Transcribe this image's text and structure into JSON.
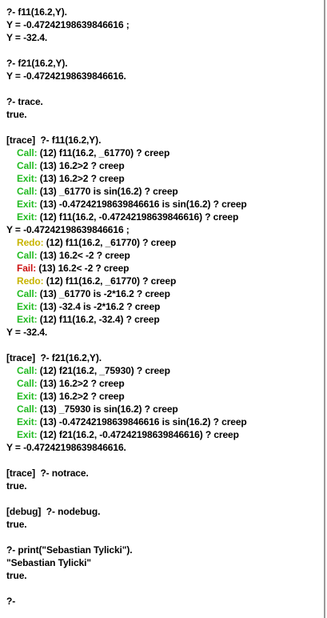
{
  "lines": [
    {
      "text": "?- f11(16.2,Y)."
    },
    {
      "text": "Y = -0.47242198639846616 ;"
    },
    {
      "text": "Y = -32.4."
    },
    {
      "text": ""
    },
    {
      "text": "?- f21(16.2,Y)."
    },
    {
      "text": "Y = -0.47242198639846616."
    },
    {
      "text": ""
    },
    {
      "text": "?- trace."
    },
    {
      "text": "true.",
      "kind": "bold"
    },
    {
      "text": ""
    },
    {
      "text": "[trace]  ?- f11(16.2,Y)."
    },
    {
      "port": "Call:",
      "kind": "call",
      "text": " (12) f11(16.2, _61770) ? creep"
    },
    {
      "port": "Call:",
      "kind": "call",
      "text": " (13) 16.2>2 ? creep"
    },
    {
      "port": "Exit:",
      "kind": "exit",
      "text": " (13) 16.2>2 ? creep"
    },
    {
      "port": "Call:",
      "kind": "call",
      "text": " (13) _61770 is sin(16.2) ? creep"
    },
    {
      "port": "Exit:",
      "kind": "exit",
      "text": " (13) -0.47242198639846616 is sin(16.2) ? creep"
    },
    {
      "port": "Exit:",
      "kind": "exit",
      "text": " (12) f11(16.2, -0.47242198639846616) ? creep"
    },
    {
      "text": "Y = -0.47242198639846616 ;"
    },
    {
      "port": "Redo:",
      "kind": "redo",
      "text": " (12) f11(16.2, _61770) ? creep"
    },
    {
      "port": "Call:",
      "kind": "call",
      "text": " (13) 16.2< -2 ? creep"
    },
    {
      "port": "Fail:",
      "kind": "fail",
      "text": " (13) 16.2< -2 ? creep"
    },
    {
      "port": "Redo:",
      "kind": "redo",
      "text": " (12) f11(16.2, _61770) ? creep"
    },
    {
      "port": "Call:",
      "kind": "call",
      "text": " (13) _61770 is -2*16.2 ? creep"
    },
    {
      "port": "Exit:",
      "kind": "exit",
      "text": " (13) -32.4 is -2*16.2 ? creep"
    },
    {
      "port": "Exit:",
      "kind": "exit",
      "text": " (12) f11(16.2, -32.4) ? creep"
    },
    {
      "text": "Y = -32.4."
    },
    {
      "text": ""
    },
    {
      "text": "[trace]  ?- f21(16.2,Y)."
    },
    {
      "port": "Call:",
      "kind": "call",
      "text": " (12) f21(16.2, _75930) ? creep"
    },
    {
      "port": "Call:",
      "kind": "call",
      "text": " (13) 16.2>2 ? creep"
    },
    {
      "port": "Exit:",
      "kind": "exit",
      "text": " (13) 16.2>2 ? creep"
    },
    {
      "port": "Call:",
      "kind": "call",
      "text": " (13) _75930 is sin(16.2) ? creep"
    },
    {
      "port": "Exit:",
      "kind": "exit",
      "text": " (13) -0.47242198639846616 is sin(16.2) ? creep"
    },
    {
      "port": "Exit:",
      "kind": "exit",
      "text": " (12) f21(16.2, -0.47242198639846616) ? creep"
    },
    {
      "text": "Y = -0.47242198639846616."
    },
    {
      "text": ""
    },
    {
      "text": "[trace]  ?- notrace."
    },
    {
      "text": "true.",
      "kind": "bold"
    },
    {
      "text": ""
    },
    {
      "text": "[debug]  ?- nodebug."
    },
    {
      "text": "true.",
      "kind": "bold"
    },
    {
      "text": ""
    },
    {
      "text": "?- print(\"Sebastian Tylicki\")."
    },
    {
      "text": "\"Sebastian Tylicki\""
    },
    {
      "text": "true.",
      "kind": "bold"
    },
    {
      "text": ""
    },
    {
      "text": "?-"
    }
  ],
  "colors": {
    "background": "#ffffff",
    "text": "#000000",
    "call_exit": "#22bb22",
    "redo": "#c7b400",
    "fail": "#cc1111"
  }
}
